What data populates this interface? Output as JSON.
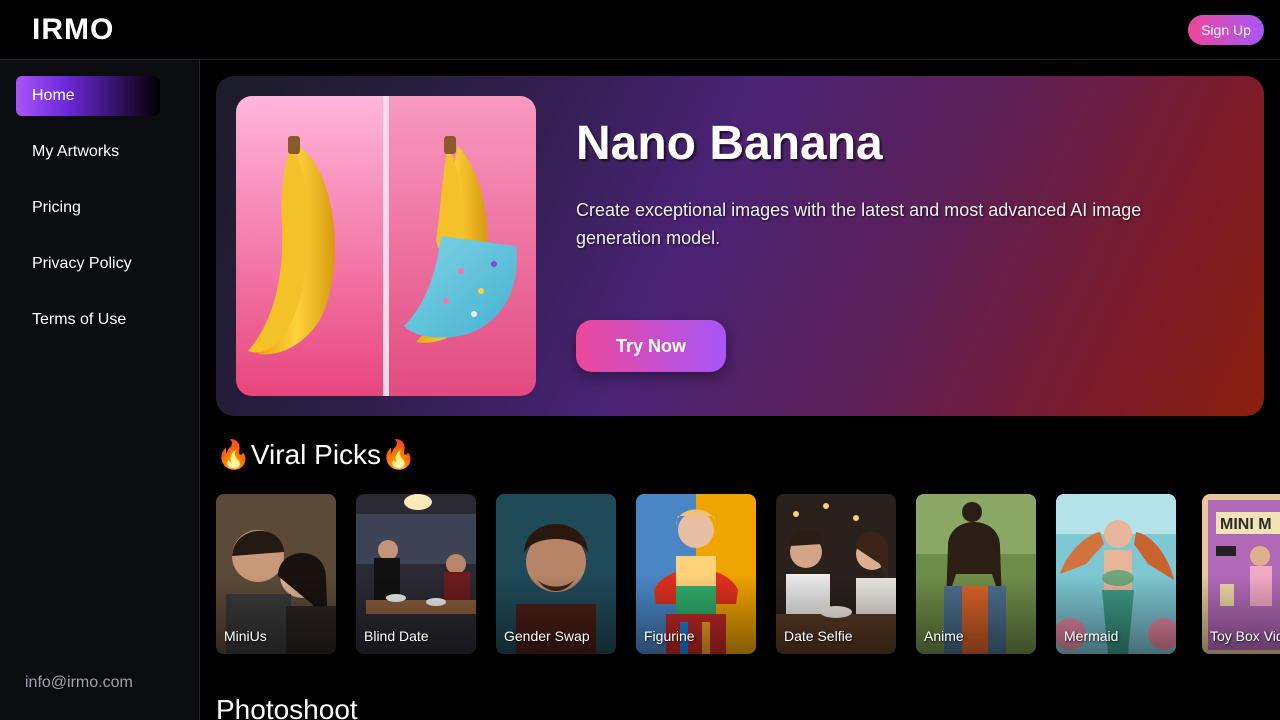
{
  "header": {
    "logo": "IRMO",
    "signup_label": "Sign Up"
  },
  "sidebar": {
    "items": [
      {
        "label": "Home",
        "active": true
      },
      {
        "label": "My Artworks"
      },
      {
        "label": "Pricing"
      },
      {
        "label": "Privacy Policy"
      },
      {
        "label": "Terms of Use"
      }
    ],
    "email": "info@irmo.com"
  },
  "hero": {
    "title": "Nano Banana",
    "description": "Create exceptional images with the latest and most advanced AI image generation model.",
    "cta_label": "Try Now"
  },
  "viral": {
    "title": "🔥Viral Picks🔥",
    "cards": [
      {
        "label": "MiniUs"
      },
      {
        "label": "Blind Date"
      },
      {
        "label": "Gender Swap"
      },
      {
        "label": "Figurine"
      },
      {
        "label": "Date Selfie"
      },
      {
        "label": "Anime"
      },
      {
        "label": "Mermaid"
      },
      {
        "label": "Toy Box Video"
      }
    ]
  },
  "photoshoot": {
    "title": "Photoshoot"
  },
  "colors": {
    "accent_pink": "#ec4899",
    "accent_purple": "#a855f7",
    "background": "#000000",
    "sidebar_bg": "#0b0c10"
  }
}
